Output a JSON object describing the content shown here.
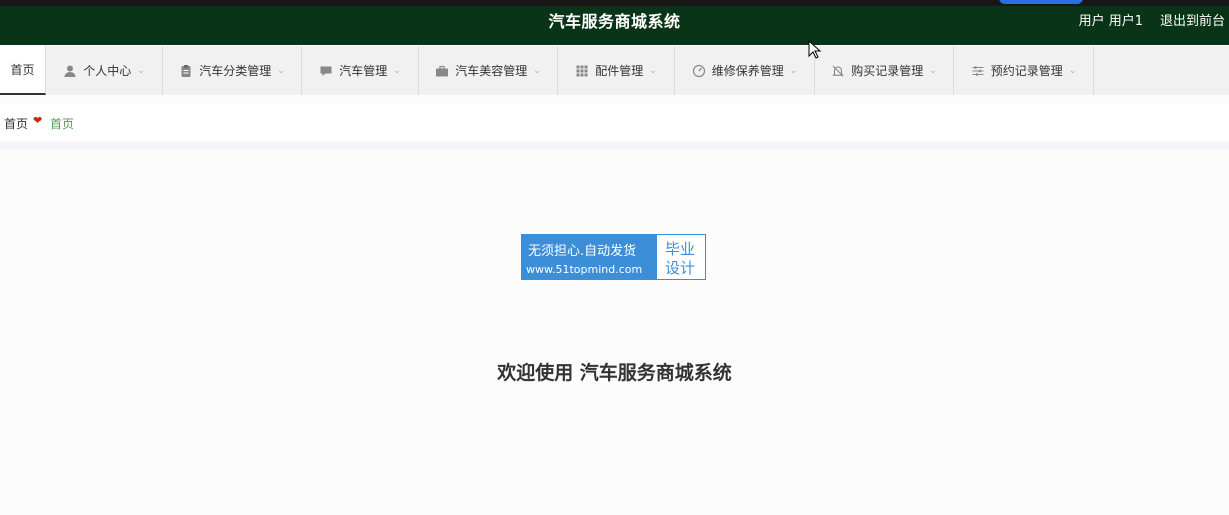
{
  "header": {
    "title": "汽车服务商城系统",
    "user": "用户 用户1",
    "logout": "退出到前台"
  },
  "nav": [
    {
      "label": "首页",
      "icon": "none",
      "active": true
    },
    {
      "label": "个人中心",
      "icon": "person-icon"
    },
    {
      "label": "汽车分类管理",
      "icon": "clipboard-icon"
    },
    {
      "label": "汽车管理",
      "icon": "chat-icon"
    },
    {
      "label": "汽车美容管理",
      "icon": "briefcase-icon"
    },
    {
      "label": "配件管理",
      "icon": "grid-icon"
    },
    {
      "label": "维修保养管理",
      "icon": "gauge-icon"
    },
    {
      "label": "购买记录管理",
      "icon": "bell-off-icon"
    },
    {
      "label": "预约记录管理",
      "icon": "sliders-icon"
    }
  ],
  "breadcrumb": {
    "home": "首页",
    "current": "首页"
  },
  "stamp": {
    "line1": "无须担心.自动发货",
    "line2": "www.51topmind.com",
    "right1": "毕业",
    "right2": "设计"
  },
  "welcome": "欢迎使用 汽车服务商城系统",
  "colors": {
    "header_bg": "#0a3417",
    "accent_green": "#4f9b55",
    "heart_red": "#d81e06",
    "stamp_blue": "#3d8ed8"
  }
}
